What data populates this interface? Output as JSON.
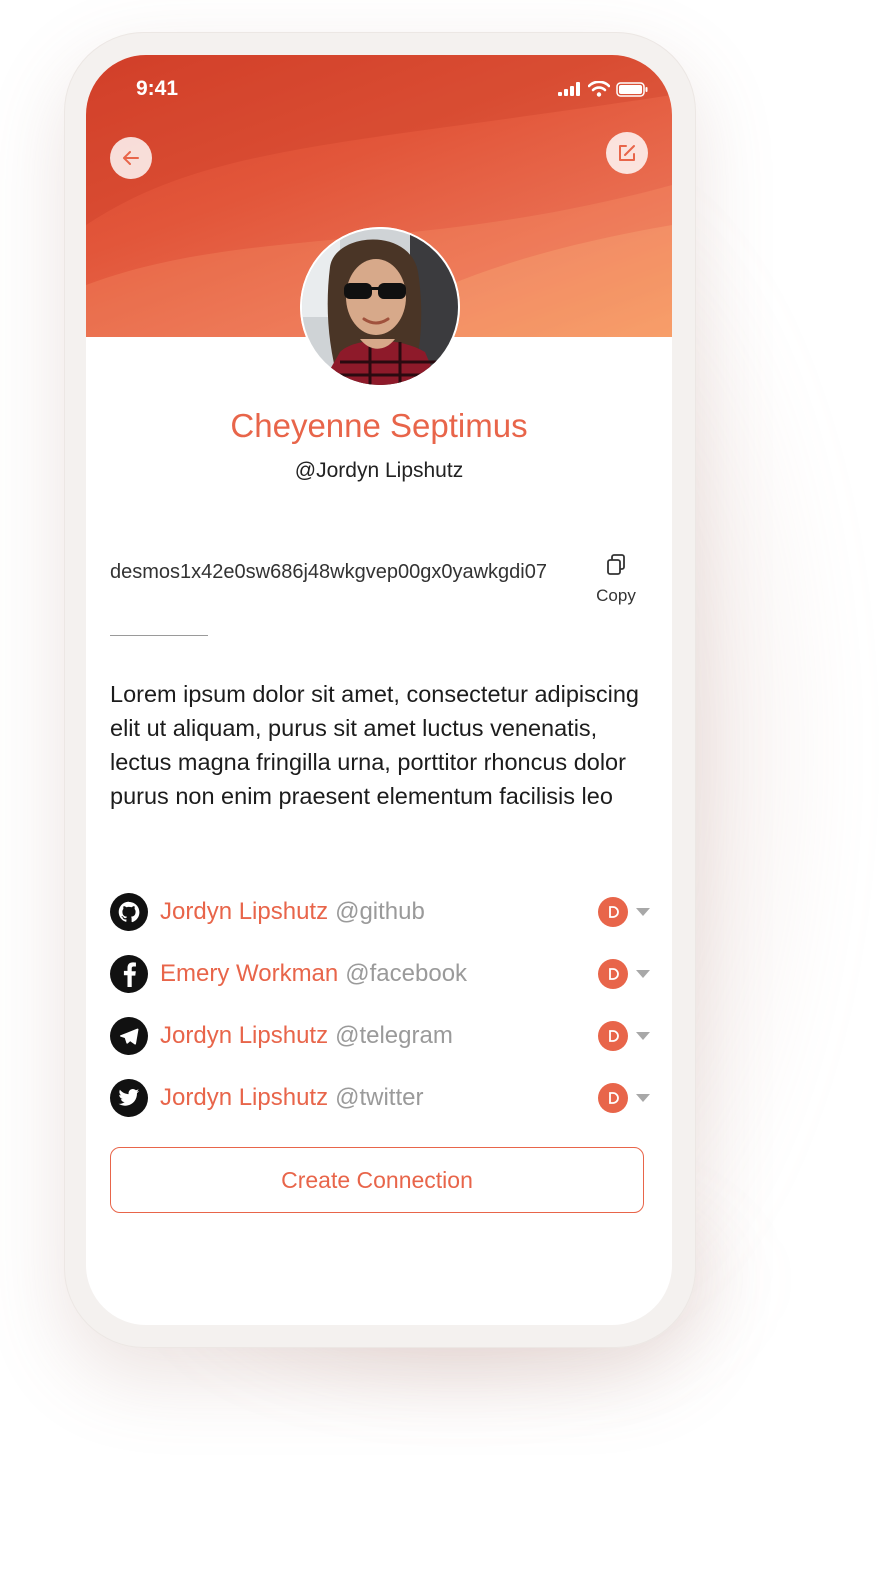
{
  "status_bar": {
    "time": "9:41"
  },
  "profile": {
    "name": "Cheyenne Septimus",
    "handle": "@Jordyn Lipshutz",
    "address": "desmos1x42e0sw686j48wkgvep00gx0yawkgdi07",
    "copy_label": "Copy",
    "bio": "Lorem ipsum dolor sit amet, consectetur adipiscing elit ut aliquam, purus sit amet luctus venenatis, lectus magna fringilla urna, porttitor rhoncus dolor purus non enim praesent elementum facilisis leo"
  },
  "links": [
    {
      "name": "Jordyn Lipshutz",
      "platform": "@github",
      "icon": "github-icon"
    },
    {
      "name": "Emery Workman",
      "platform": "@facebook",
      "icon": "facebook-icon"
    },
    {
      "name": "Jordyn Lipshutz",
      "platform": "@telegram",
      "icon": "telegram-icon"
    },
    {
      "name": "Jordyn Lipshutz",
      "platform": "@twitter",
      "icon": "twitter-icon"
    }
  ],
  "actions": {
    "create_connection": "Create Connection"
  },
  "colors": {
    "accent": "#e8654a",
    "header_start": "#d8432c",
    "header_end": "#f28e5b",
    "muted": "#9a9a9a"
  }
}
